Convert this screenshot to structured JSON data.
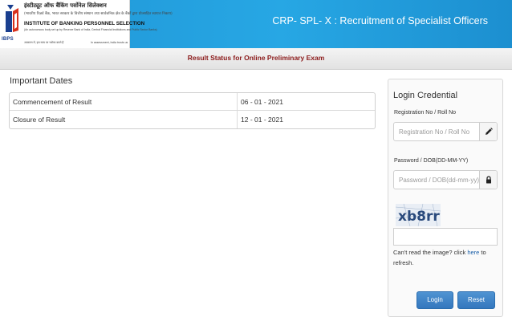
{
  "header": {
    "title": "CRP- SPL- X : Recruitment of Specialist Officers",
    "logo": {
      "brand": "IBPS",
      "hindi_name": "इंस्टीट्यूट ऑफ बैंकिंग पर्सोनेल सिलेक्शन",
      "hindi_sub": "(भारतीय रिज़र्व बैंक, भारत सरकार के वित्तीय संस्थान तथा सार्वजनिक क्षेत्र के बैंकों द्वारा प्रोत्साहित स्वायत्त निकाय)",
      "name": "INSTITUTE OF BANKING PERSONNEL SELECTION",
      "sub": "(An autonomous body set up by Reserve Bank of India, Central Financial Institutions and Public Sector Banks)",
      "tagline_hindi": "आकलन में, हम सत्य पर भरोसा करते हैं",
      "tagline": "In assessment, India trusts us"
    }
  },
  "subheader": {
    "text": "Result Status for Online Preliminary Exam"
  },
  "dates": {
    "title": "Important Dates",
    "rows": [
      {
        "label": "Commencement of Result",
        "value": "06 - 01 - 2021"
      },
      {
        "label": "Closure of Result",
        "value": "12 - 01 - 2021"
      }
    ]
  },
  "login": {
    "title": "Login Credential",
    "reg_label": "Registration No / Roll No",
    "reg_placeholder": "Registration No / Roll No",
    "pwd_label": "Password / DOB(DD-MM-YY)",
    "pwd_placeholder": "Password / DOB(dd-mm-yy)",
    "captcha_text": "xb8rr",
    "help_prefix": "Can't read the image? click ",
    "help_link": "here",
    "help_suffix": " to refresh.",
    "login_label": "Login",
    "reset_label": "Reset"
  },
  "icons": {
    "reg_icon": "pencil-icon",
    "pwd_icon": "lock-icon"
  },
  "colors": {
    "header_blue": "#27a7e4",
    "subheader_text": "#8b1a1a",
    "button_blue": "#3f86c8"
  }
}
